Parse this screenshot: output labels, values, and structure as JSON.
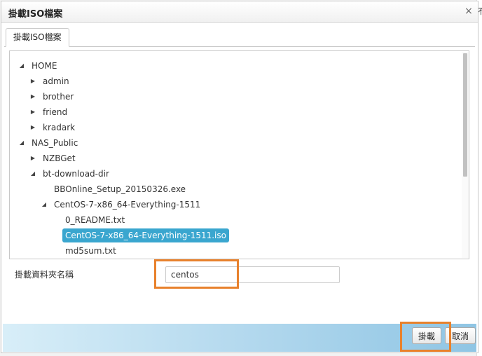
{
  "dialog": {
    "title": "掛載ISO檔案",
    "close_glyph": "×"
  },
  "background": {
    "edge_char": "不"
  },
  "tabs": [
    {
      "label": "掛載ISO檔案",
      "active": true
    }
  ],
  "tree": [
    {
      "label": "HOME",
      "toggle": "expanded"
    },
    {
      "label": "admin",
      "toggle": "collapsed"
    },
    {
      "label": "brother",
      "toggle": "collapsed"
    },
    {
      "label": "friend",
      "toggle": "collapsed"
    },
    {
      "label": "kradark",
      "toggle": "collapsed"
    },
    {
      "label": "NAS_Public",
      "toggle": "expanded"
    },
    {
      "label": "NZBGet",
      "toggle": "collapsed"
    },
    {
      "label": "bt-download-dir",
      "toggle": "expanded"
    },
    {
      "label": "BBOnline_Setup_20150326.exe",
      "toggle": "none"
    },
    {
      "label": "CentOS-7-x86_64-Everything-1511",
      "toggle": "expanded"
    },
    {
      "label": "0_README.txt",
      "toggle": "none"
    },
    {
      "label": "CentOS-7-x86_64-Everything-1511.iso",
      "toggle": "none",
      "selected": true
    },
    {
      "label": "md5sum.txt",
      "toggle": "none"
    }
  ],
  "form": {
    "label": "掛載資料夾名稱",
    "value": "centos"
  },
  "buttons": {
    "mount": "掛載",
    "cancel": "取消"
  },
  "icons": {
    "expanded": "◢",
    "collapsed": "▶"
  },
  "colors": {
    "selection": "#3aa6cf",
    "highlight": "#e8812c"
  }
}
